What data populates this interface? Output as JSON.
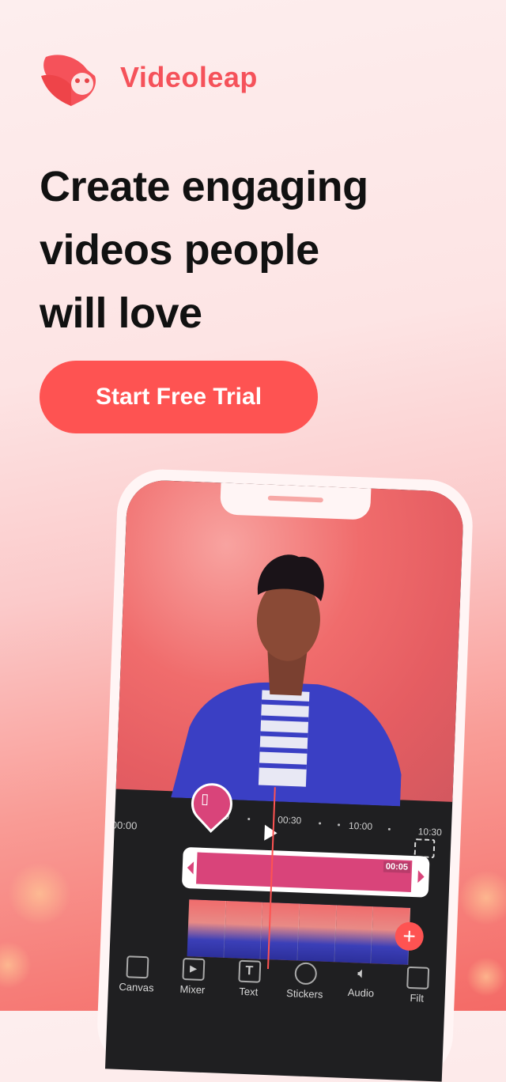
{
  "brand": {
    "name": "Videoleap",
    "accent_color": "#f5525a",
    "logo_icon": "fox-logo-icon"
  },
  "headline": {
    "lines": [
      "Create engaging",
      "videos people",
      "will love"
    ]
  },
  "cta": {
    "label": "Start Free Trial",
    "color": "#fe5352"
  },
  "phone": {
    "timeline": {
      "start_time": "00:00",
      "ruler_labels": [
        "00:30",
        "10:00",
        "10:30"
      ],
      "ruler_partial": "0",
      "clip_duration": "00:05",
      "clip_color": "#d9447a"
    },
    "toolbar": [
      {
        "label": "Canvas",
        "icon": "canvas-icon"
      },
      {
        "label": "Mixer",
        "icon": "mixer-icon"
      },
      {
        "label": "Text",
        "icon": "text-icon"
      },
      {
        "label": "Stickers",
        "icon": "stickers-icon"
      },
      {
        "label": "Audio",
        "icon": "audio-icon"
      },
      {
        "label": "Filt",
        "icon": "filters-icon"
      }
    ],
    "add_label": "+",
    "text_glyph": "T"
  }
}
